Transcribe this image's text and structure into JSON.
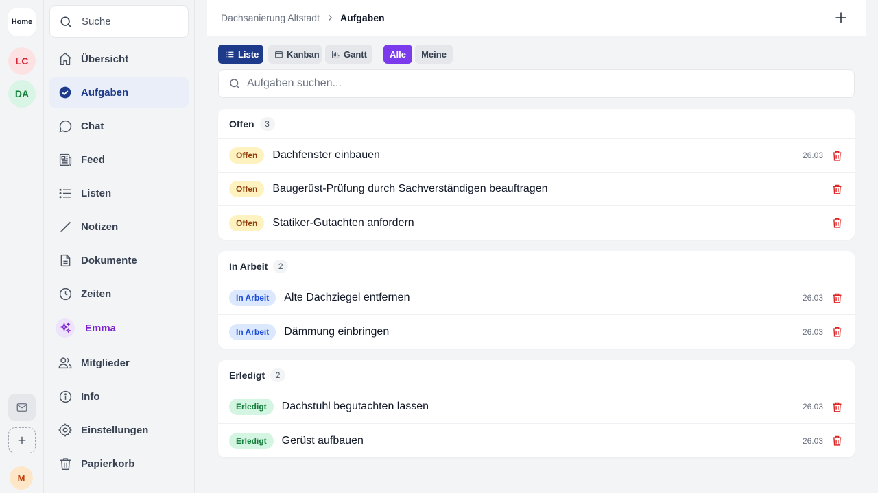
{
  "rail": {
    "home_label": "Home",
    "workspaces": [
      "LC",
      "DA"
    ],
    "user_initial": "M"
  },
  "sidebar": {
    "search_label": "Suche",
    "items": [
      {
        "label": "Übersicht",
        "icon": "home-icon"
      },
      {
        "label": "Aufgaben",
        "icon": "check-circle-icon",
        "active": true
      },
      {
        "label": "Chat",
        "icon": "chat-bubble-icon"
      },
      {
        "label": "Feed",
        "icon": "newspaper-icon"
      },
      {
        "label": "Listen",
        "icon": "list-icon"
      },
      {
        "label": "Notizen",
        "icon": "pencil-icon"
      },
      {
        "label": "Dokumente",
        "icon": "document-icon"
      },
      {
        "label": "Zeiten",
        "icon": "clock-icon"
      },
      {
        "label": "Emma",
        "icon": "sparkles-icon"
      },
      {
        "label": "Mitglieder",
        "icon": "users-icon"
      },
      {
        "label": "Info",
        "icon": "info-icon"
      },
      {
        "label": "Einstellungen",
        "icon": "gear-icon"
      },
      {
        "label": "Papierkorb",
        "icon": "trash-icon"
      }
    ]
  },
  "header": {
    "breadcrumb_root": "Dachsanierung Altstadt",
    "breadcrumb_current": "Aufgaben"
  },
  "toolbar": {
    "views": [
      "Liste",
      "Kanban",
      "Gantt"
    ],
    "active_view": "Liste",
    "filters": [
      "Alle",
      "Meine"
    ],
    "active_filter": "Alle"
  },
  "task_search": {
    "placeholder": "Aufgaben suchen..."
  },
  "colors": {
    "primary": "#1e3a8a",
    "accent_purple": "#7c3aed",
    "delete_red": "#dc2626"
  },
  "groups": [
    {
      "title": "Offen",
      "count": "3",
      "tasks": [
        {
          "status": "Offen",
          "title": "Dachfenster einbauen",
          "date": "26.03"
        },
        {
          "status": "Offen",
          "title": "Baugerüst-Prüfung durch Sachverständigen beauftragen",
          "date": ""
        },
        {
          "status": "Offen",
          "title": "Statiker-Gutachten anfordern",
          "date": ""
        }
      ]
    },
    {
      "title": "In Arbeit",
      "count": "2",
      "tasks": [
        {
          "status": "In Arbeit",
          "title": "Alte Dachziegel entfernen",
          "date": "26.03"
        },
        {
          "status": "In Arbeit",
          "title": "Dämmung einbringen",
          "date": "26.03"
        }
      ]
    },
    {
      "title": "Erledigt",
      "count": "2",
      "tasks": [
        {
          "status": "Erledigt",
          "title": "Dachstuhl begutachten lassen",
          "date": "26.03"
        },
        {
          "status": "Erledigt",
          "title": "Gerüst aufbauen",
          "date": "26.03"
        }
      ]
    }
  ]
}
